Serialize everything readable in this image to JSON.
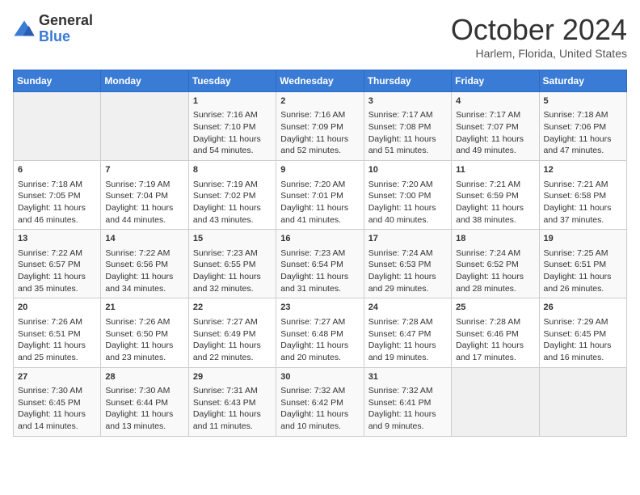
{
  "logo": {
    "general": "General",
    "blue": "Blue"
  },
  "title": "October 2024",
  "location": "Harlem, Florida, United States",
  "days_of_week": [
    "Sunday",
    "Monday",
    "Tuesday",
    "Wednesday",
    "Thursday",
    "Friday",
    "Saturday"
  ],
  "weeks": [
    [
      {
        "day": "",
        "info": ""
      },
      {
        "day": "",
        "info": ""
      },
      {
        "day": "1",
        "info": "Sunrise: 7:16 AM\nSunset: 7:10 PM\nDaylight: 11 hours and 54 minutes."
      },
      {
        "day": "2",
        "info": "Sunrise: 7:16 AM\nSunset: 7:09 PM\nDaylight: 11 hours and 52 minutes."
      },
      {
        "day": "3",
        "info": "Sunrise: 7:17 AM\nSunset: 7:08 PM\nDaylight: 11 hours and 51 minutes."
      },
      {
        "day": "4",
        "info": "Sunrise: 7:17 AM\nSunset: 7:07 PM\nDaylight: 11 hours and 49 minutes."
      },
      {
        "day": "5",
        "info": "Sunrise: 7:18 AM\nSunset: 7:06 PM\nDaylight: 11 hours and 47 minutes."
      }
    ],
    [
      {
        "day": "6",
        "info": "Sunrise: 7:18 AM\nSunset: 7:05 PM\nDaylight: 11 hours and 46 minutes."
      },
      {
        "day": "7",
        "info": "Sunrise: 7:19 AM\nSunset: 7:04 PM\nDaylight: 11 hours and 44 minutes."
      },
      {
        "day": "8",
        "info": "Sunrise: 7:19 AM\nSunset: 7:02 PM\nDaylight: 11 hours and 43 minutes."
      },
      {
        "day": "9",
        "info": "Sunrise: 7:20 AM\nSunset: 7:01 PM\nDaylight: 11 hours and 41 minutes."
      },
      {
        "day": "10",
        "info": "Sunrise: 7:20 AM\nSunset: 7:00 PM\nDaylight: 11 hours and 40 minutes."
      },
      {
        "day": "11",
        "info": "Sunrise: 7:21 AM\nSunset: 6:59 PM\nDaylight: 11 hours and 38 minutes."
      },
      {
        "day": "12",
        "info": "Sunrise: 7:21 AM\nSunset: 6:58 PM\nDaylight: 11 hours and 37 minutes."
      }
    ],
    [
      {
        "day": "13",
        "info": "Sunrise: 7:22 AM\nSunset: 6:57 PM\nDaylight: 11 hours and 35 minutes."
      },
      {
        "day": "14",
        "info": "Sunrise: 7:22 AM\nSunset: 6:56 PM\nDaylight: 11 hours and 34 minutes."
      },
      {
        "day": "15",
        "info": "Sunrise: 7:23 AM\nSunset: 6:55 PM\nDaylight: 11 hours and 32 minutes."
      },
      {
        "day": "16",
        "info": "Sunrise: 7:23 AM\nSunset: 6:54 PM\nDaylight: 11 hours and 31 minutes."
      },
      {
        "day": "17",
        "info": "Sunrise: 7:24 AM\nSunset: 6:53 PM\nDaylight: 11 hours and 29 minutes."
      },
      {
        "day": "18",
        "info": "Sunrise: 7:24 AM\nSunset: 6:52 PM\nDaylight: 11 hours and 28 minutes."
      },
      {
        "day": "19",
        "info": "Sunrise: 7:25 AM\nSunset: 6:51 PM\nDaylight: 11 hours and 26 minutes."
      }
    ],
    [
      {
        "day": "20",
        "info": "Sunrise: 7:26 AM\nSunset: 6:51 PM\nDaylight: 11 hours and 25 minutes."
      },
      {
        "day": "21",
        "info": "Sunrise: 7:26 AM\nSunset: 6:50 PM\nDaylight: 11 hours and 23 minutes."
      },
      {
        "day": "22",
        "info": "Sunrise: 7:27 AM\nSunset: 6:49 PM\nDaylight: 11 hours and 22 minutes."
      },
      {
        "day": "23",
        "info": "Sunrise: 7:27 AM\nSunset: 6:48 PM\nDaylight: 11 hours and 20 minutes."
      },
      {
        "day": "24",
        "info": "Sunrise: 7:28 AM\nSunset: 6:47 PM\nDaylight: 11 hours and 19 minutes."
      },
      {
        "day": "25",
        "info": "Sunrise: 7:28 AM\nSunset: 6:46 PM\nDaylight: 11 hours and 17 minutes."
      },
      {
        "day": "26",
        "info": "Sunrise: 7:29 AM\nSunset: 6:45 PM\nDaylight: 11 hours and 16 minutes."
      }
    ],
    [
      {
        "day": "27",
        "info": "Sunrise: 7:30 AM\nSunset: 6:45 PM\nDaylight: 11 hours and 14 minutes."
      },
      {
        "day": "28",
        "info": "Sunrise: 7:30 AM\nSunset: 6:44 PM\nDaylight: 11 hours and 13 minutes."
      },
      {
        "day": "29",
        "info": "Sunrise: 7:31 AM\nSunset: 6:43 PM\nDaylight: 11 hours and 11 minutes."
      },
      {
        "day": "30",
        "info": "Sunrise: 7:32 AM\nSunset: 6:42 PM\nDaylight: 11 hours and 10 minutes."
      },
      {
        "day": "31",
        "info": "Sunrise: 7:32 AM\nSunset: 6:41 PM\nDaylight: 11 hours and 9 minutes."
      },
      {
        "day": "",
        "info": ""
      },
      {
        "day": "",
        "info": ""
      }
    ]
  ]
}
